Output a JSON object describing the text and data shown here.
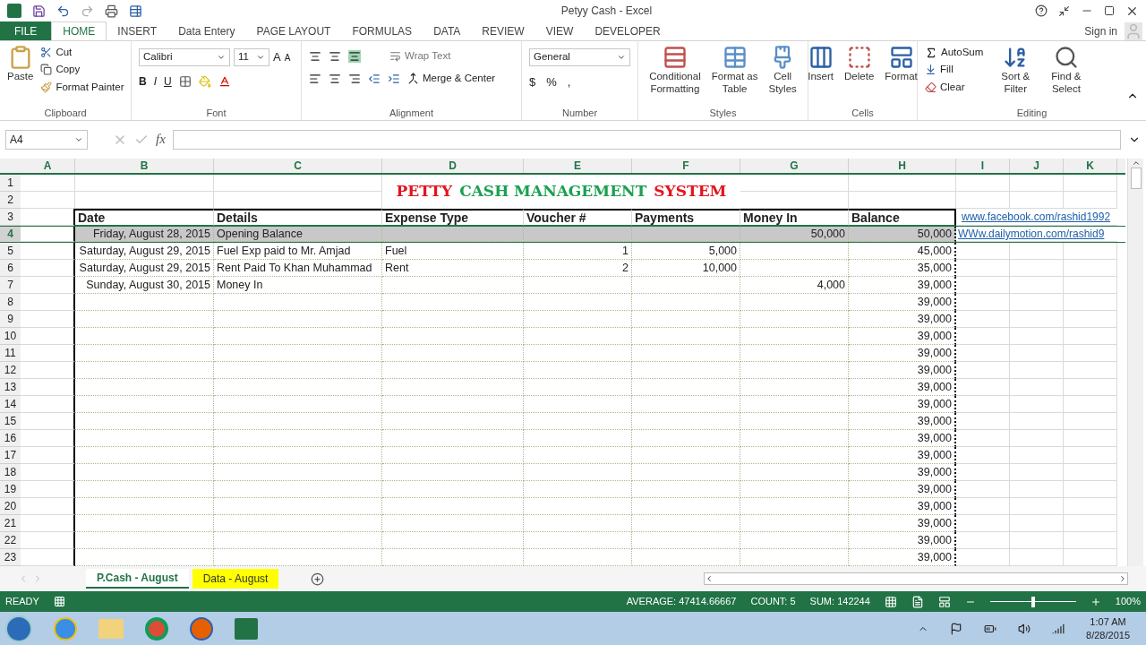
{
  "window": {
    "title": "Petyy Cash - Excel"
  },
  "menu_tabs": [
    {
      "label": "FILE",
      "kind": "file",
      "selected": false
    },
    {
      "label": "HOME",
      "kind": "tab",
      "selected": true
    },
    {
      "label": "INSERT",
      "kind": "tab",
      "selected": false
    },
    {
      "label": "Data Entery",
      "kind": "tab",
      "selected": false
    },
    {
      "label": "PAGE LAYOUT",
      "kind": "tab",
      "selected": false
    },
    {
      "label": "FORMULAS",
      "kind": "tab",
      "selected": false
    },
    {
      "label": "DATA",
      "kind": "tab",
      "selected": false
    },
    {
      "label": "REVIEW",
      "kind": "tab",
      "selected": false
    },
    {
      "label": "VIEW",
      "kind": "tab",
      "selected": false
    },
    {
      "label": "DEVELOPER",
      "kind": "tab",
      "selected": false
    }
  ],
  "sign_in": "Sign in",
  "ribbon": {
    "clipboard": {
      "paste": "Paste",
      "cut": "Cut",
      "copy": "Copy",
      "format_painter": "Format Painter",
      "label": "Clipboard"
    },
    "font": {
      "name": "Calibri",
      "size": "11",
      "grow": "A",
      "shrink": "A",
      "bold": "B",
      "italic": "I",
      "underline": "U",
      "label": "Font"
    },
    "alignment": {
      "wrap_text": "Wrap Text",
      "merge_center": "Merge & Center",
      "label": "Alignment"
    },
    "number": {
      "format": "General",
      "currency": "$",
      "percent": "%",
      "comma": ",",
      "label": "Number"
    },
    "styles": {
      "items": [
        [
          "Conditional",
          "Formatting"
        ],
        [
          "Format as",
          "Table"
        ],
        [
          "Cell",
          "Styles"
        ]
      ],
      "label": "Styles"
    },
    "cells": {
      "items": [
        "Insert",
        "Delete",
        "Format"
      ],
      "label": "Cells"
    },
    "editing": {
      "autosum": "AutoSum",
      "fill": "Fill",
      "clear": "Clear",
      "sort": [
        "Sort &",
        "Filter"
      ],
      "find": [
        "Find &",
        "Select"
      ],
      "label": "Editing"
    }
  },
  "name_box": "A4",
  "function_symbol": "fx",
  "columns": [
    "A",
    "B",
    "C",
    "D",
    "E",
    "F",
    "G",
    "H",
    "I",
    "J",
    "K"
  ],
  "title_parts": [
    {
      "text": "PETTY",
      "color": "#e3141c"
    },
    {
      "text": "CASH MANAGEMENT",
      "color": "#1aa04f"
    },
    {
      "text": "SYSTEM",
      "color": "#e3141c"
    }
  ],
  "headers": [
    "Date",
    "Details",
    "Expense Type",
    "Voucher #",
    "Payments",
    "Money In",
    "Balance"
  ],
  "top_rows": [
    "1",
    "2",
    "3"
  ],
  "links": [
    "www.facebook.com/rashid1992",
    "WWw.dailymotion.com/rashid9"
  ],
  "rows": [
    {
      "number": "4",
      "selected": true,
      "date": "Friday, August 28, 2015",
      "details": "Opening Balance",
      "money_in": "50,000",
      "balance": "50,000"
    },
    {
      "number": "5",
      "selected": false,
      "date": "Saturday, August 29, 2015",
      "details": "Fuel Exp paid to Mr. Amjad",
      "expense_type": "Fuel",
      "voucher": "1",
      "payments": "5,000",
      "balance": "45,000"
    },
    {
      "number": "6",
      "selected": false,
      "date": "Saturday, August 29, 2015",
      "details": "Rent Paid To Khan Muhammad",
      "expense_type": "Rent",
      "voucher": "2",
      "payments": "10,000",
      "balance": "35,000"
    },
    {
      "number": "7",
      "selected": false,
      "date": "Sunday, August 30, 2015",
      "details": "Money  In",
      "money_in": "4,000",
      "balance": "39,000"
    },
    {
      "number": "8",
      "selected": false,
      "balance": "39,000"
    },
    {
      "number": "9",
      "selected": false,
      "balance": "39,000"
    },
    {
      "number": "10",
      "selected": false,
      "balance": "39,000"
    },
    {
      "number": "11",
      "selected": false,
      "balance": "39,000"
    },
    {
      "number": "12",
      "selected": false,
      "balance": "39,000"
    },
    {
      "number": "13",
      "selected": false,
      "balance": "39,000"
    },
    {
      "number": "14",
      "selected": false,
      "balance": "39,000"
    },
    {
      "number": "15",
      "selected": false,
      "balance": "39,000"
    },
    {
      "number": "16",
      "selected": false,
      "balance": "39,000"
    },
    {
      "number": "17",
      "selected": false,
      "balance": "39,000"
    },
    {
      "number": "18",
      "selected": false,
      "balance": "39,000"
    },
    {
      "number": "19",
      "selected": false,
      "balance": "39,000"
    },
    {
      "number": "20",
      "selected": false,
      "balance": "39,000"
    },
    {
      "number": "21",
      "selected": false,
      "balance": "39,000"
    },
    {
      "number": "22",
      "selected": false,
      "balance": "39,000"
    },
    {
      "number": "23",
      "selected": false,
      "balance": "39,000"
    }
  ],
  "sheet_tabs": [
    {
      "label": "P.Cash - August",
      "selected": true,
      "color": "#ffffff"
    },
    {
      "label": "Data - August",
      "selected": false,
      "color": "#ffff00"
    }
  ],
  "zoom_slider": {
    "level": 0.5
  },
  "status": {
    "mode": "READY",
    "average": "AVERAGE: 47414.66667",
    "count": "COUNT: 5",
    "sum": "SUM: 142244",
    "zoom": "100%"
  },
  "clock": {
    "time": "1:07 AM",
    "date": "8/28/2015"
  }
}
